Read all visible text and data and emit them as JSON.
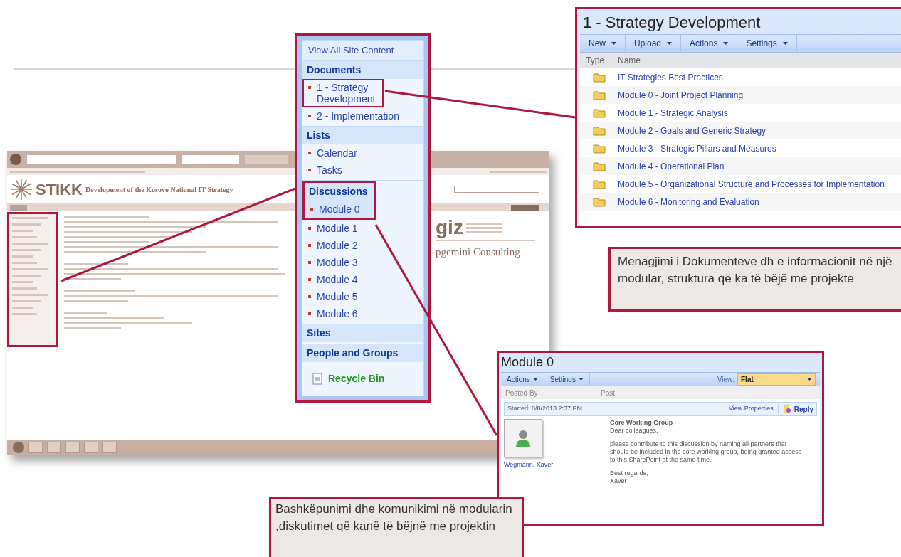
{
  "background_window": {
    "logo_text": "STIKK",
    "site_title": "Development of the Kosovo National IT Strategy",
    "sidebar_highlighted": true,
    "sponsor": {
      "logo": "giz",
      "consultant": "pgemini Consulting"
    }
  },
  "quick_launch": {
    "top_link": "View All Site Content",
    "sections": [
      {
        "heading": "Documents",
        "highlighted": false,
        "items": [
          {
            "label": "1 - Strategy Development",
            "highlighted": true
          },
          {
            "label": "2 - Implementation",
            "highlighted": false
          }
        ]
      },
      {
        "heading": "Lists",
        "highlighted": false,
        "items": [
          {
            "label": "Calendar",
            "highlighted": false
          },
          {
            "label": "Tasks",
            "highlighted": false
          }
        ]
      },
      {
        "heading": "Discussions",
        "highlighted": true,
        "items": [
          {
            "label": "Module 0",
            "highlighted": false
          },
          {
            "label": "Module 1",
            "highlighted": false
          },
          {
            "label": "Module 2",
            "highlighted": false
          },
          {
            "label": "Module 3",
            "highlighted": false
          },
          {
            "label": "Module 4",
            "highlighted": false
          },
          {
            "label": "Module 5",
            "highlighted": false
          },
          {
            "label": "Module 6",
            "highlighted": false
          }
        ]
      },
      {
        "heading": "Sites",
        "highlighted": false
      },
      {
        "heading": "People and Groups",
        "highlighted": false
      }
    ],
    "recycle_bin": "Recycle Bin"
  },
  "library": {
    "title": "1 - Strategy Development",
    "toolbar": [
      "New",
      "Upload",
      "Actions",
      "Settings"
    ],
    "columns": [
      "Type",
      "Name"
    ],
    "rows": [
      "IT Strategies Best Practices",
      "Module 0 - Joint Project Planning",
      "Module 1 - Strategic Analysis",
      "Module 2 - Goals and Generic Strategy",
      "Module 3 - Strategic Pillars and Measures",
      "Module 4 - Operational Plan",
      "Module 5 - Organizational Structure and Processes for Implementation",
      "Module 6 - Monitoring and Evaluation"
    ]
  },
  "callout_documents": "Menagjimi i Dokumenteve dh e informacionit në një  modular, struktura që ka të bëjë me projekte",
  "discussion": {
    "title": "Module 0",
    "toolbar": [
      "Actions",
      "Settings"
    ],
    "view_label": "View:",
    "view_value": "Flat",
    "columns": [
      "Posted By",
      "Post"
    ],
    "started": "Started: 8/8/2013 2:37 PM",
    "view_properties": "View Properties",
    "reply": "Reply",
    "author": "Wegmann, Xaver",
    "subject": "Core Working Group",
    "paragraphs": [
      "Dear colleagues,",
      "please contribute to this discussion by naming all partners that should be included in the core working group, being granted access to this SharePoint at the same time.",
      "Best regards,\nXaver"
    ]
  },
  "callout_discussions": "Bashkëpunimi dhe komunikimi në modularin ,diskutimet që kanë të bëjnë me  projektin"
}
